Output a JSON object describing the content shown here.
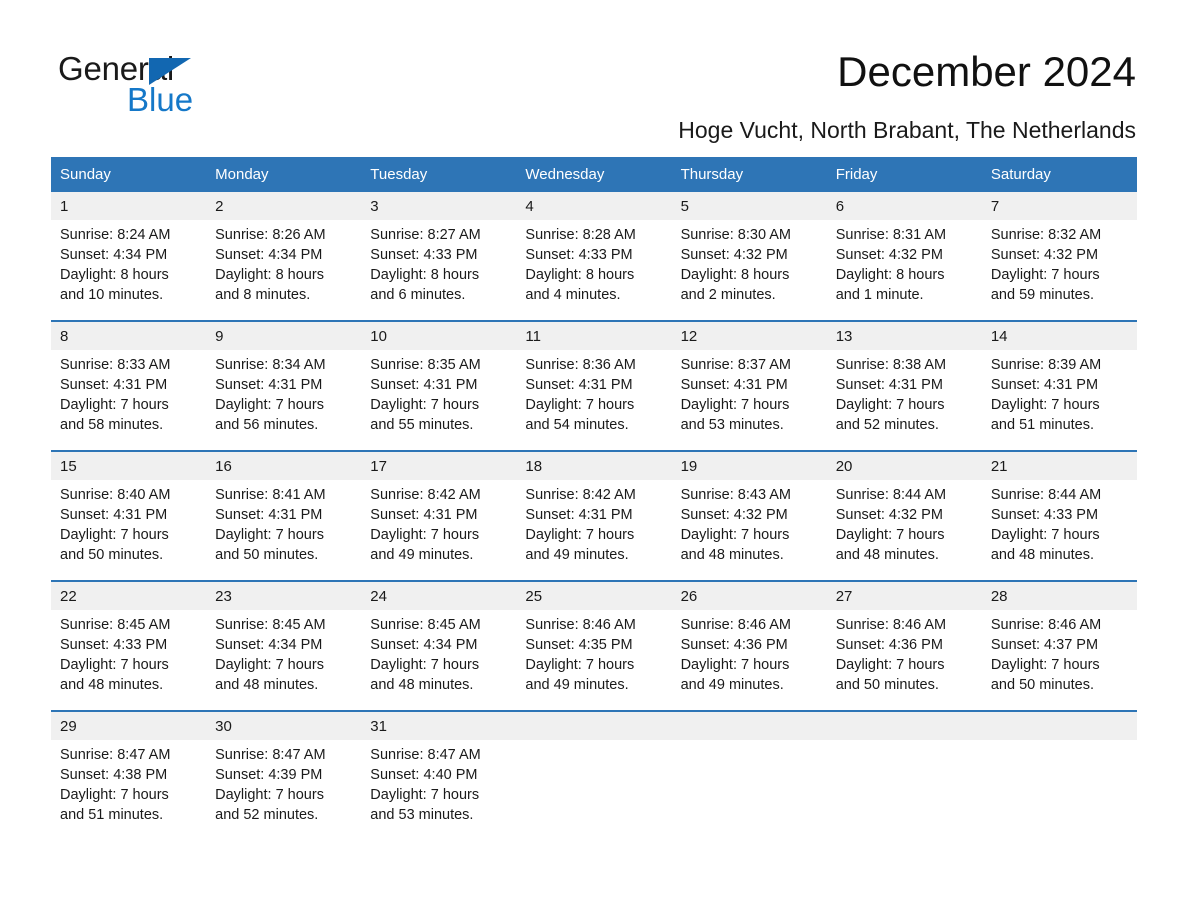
{
  "brand": {
    "name_part1": "General",
    "name_part2": "Blue",
    "accent_color": "#1578c8",
    "triangle_color": "#1267b1"
  },
  "header": {
    "title": "December 2024",
    "subtitle": "Hoge Vucht, North Brabant, The Netherlands"
  },
  "theme": {
    "header_band": "#2e75b6",
    "daynum_strip": "#f0f0f0",
    "row_divider": "#2e75b6"
  },
  "weekday_headers": [
    "Sunday",
    "Monday",
    "Tuesday",
    "Wednesday",
    "Thursday",
    "Friday",
    "Saturday"
  ],
  "weeks": [
    {
      "days": [
        {
          "day": "1",
          "sunrise": "Sunrise: 8:24 AM",
          "sunset": "Sunset: 4:34 PM",
          "daylight_1": "Daylight: 8 hours",
          "daylight_2": "and 10 minutes."
        },
        {
          "day": "2",
          "sunrise": "Sunrise: 8:26 AM",
          "sunset": "Sunset: 4:34 PM",
          "daylight_1": "Daylight: 8 hours",
          "daylight_2": "and 8 minutes."
        },
        {
          "day": "3",
          "sunrise": "Sunrise: 8:27 AM",
          "sunset": "Sunset: 4:33 PM",
          "daylight_1": "Daylight: 8 hours",
          "daylight_2": "and 6 minutes."
        },
        {
          "day": "4",
          "sunrise": "Sunrise: 8:28 AM",
          "sunset": "Sunset: 4:33 PM",
          "daylight_1": "Daylight: 8 hours",
          "daylight_2": "and 4 minutes."
        },
        {
          "day": "5",
          "sunrise": "Sunrise: 8:30 AM",
          "sunset": "Sunset: 4:32 PM",
          "daylight_1": "Daylight: 8 hours",
          "daylight_2": "and 2 minutes."
        },
        {
          "day": "6",
          "sunrise": "Sunrise: 8:31 AM",
          "sunset": "Sunset: 4:32 PM",
          "daylight_1": "Daylight: 8 hours",
          "daylight_2": "and 1 minute."
        },
        {
          "day": "7",
          "sunrise": "Sunrise: 8:32 AM",
          "sunset": "Sunset: 4:32 PM",
          "daylight_1": "Daylight: 7 hours",
          "daylight_2": "and 59 minutes."
        }
      ]
    },
    {
      "days": [
        {
          "day": "8",
          "sunrise": "Sunrise: 8:33 AM",
          "sunset": "Sunset: 4:31 PM",
          "daylight_1": "Daylight: 7 hours",
          "daylight_2": "and 58 minutes."
        },
        {
          "day": "9",
          "sunrise": "Sunrise: 8:34 AM",
          "sunset": "Sunset: 4:31 PM",
          "daylight_1": "Daylight: 7 hours",
          "daylight_2": "and 56 minutes."
        },
        {
          "day": "10",
          "sunrise": "Sunrise: 8:35 AM",
          "sunset": "Sunset: 4:31 PM",
          "daylight_1": "Daylight: 7 hours",
          "daylight_2": "and 55 minutes."
        },
        {
          "day": "11",
          "sunrise": "Sunrise: 8:36 AM",
          "sunset": "Sunset: 4:31 PM",
          "daylight_1": "Daylight: 7 hours",
          "daylight_2": "and 54 minutes."
        },
        {
          "day": "12",
          "sunrise": "Sunrise: 8:37 AM",
          "sunset": "Sunset: 4:31 PM",
          "daylight_1": "Daylight: 7 hours",
          "daylight_2": "and 53 minutes."
        },
        {
          "day": "13",
          "sunrise": "Sunrise: 8:38 AM",
          "sunset": "Sunset: 4:31 PM",
          "daylight_1": "Daylight: 7 hours",
          "daylight_2": "and 52 minutes."
        },
        {
          "day": "14",
          "sunrise": "Sunrise: 8:39 AM",
          "sunset": "Sunset: 4:31 PM",
          "daylight_1": "Daylight: 7 hours",
          "daylight_2": "and 51 minutes."
        }
      ]
    },
    {
      "days": [
        {
          "day": "15",
          "sunrise": "Sunrise: 8:40 AM",
          "sunset": "Sunset: 4:31 PM",
          "daylight_1": "Daylight: 7 hours",
          "daylight_2": "and 50 minutes."
        },
        {
          "day": "16",
          "sunrise": "Sunrise: 8:41 AM",
          "sunset": "Sunset: 4:31 PM",
          "daylight_1": "Daylight: 7 hours",
          "daylight_2": "and 50 minutes."
        },
        {
          "day": "17",
          "sunrise": "Sunrise: 8:42 AM",
          "sunset": "Sunset: 4:31 PM",
          "daylight_1": "Daylight: 7 hours",
          "daylight_2": "and 49 minutes."
        },
        {
          "day": "18",
          "sunrise": "Sunrise: 8:42 AM",
          "sunset": "Sunset: 4:31 PM",
          "daylight_1": "Daylight: 7 hours",
          "daylight_2": "and 49 minutes."
        },
        {
          "day": "19",
          "sunrise": "Sunrise: 8:43 AM",
          "sunset": "Sunset: 4:32 PM",
          "daylight_1": "Daylight: 7 hours",
          "daylight_2": "and 48 minutes."
        },
        {
          "day": "20",
          "sunrise": "Sunrise: 8:44 AM",
          "sunset": "Sunset: 4:32 PM",
          "daylight_1": "Daylight: 7 hours",
          "daylight_2": "and 48 minutes."
        },
        {
          "day": "21",
          "sunrise": "Sunrise: 8:44 AM",
          "sunset": "Sunset: 4:33 PM",
          "daylight_1": "Daylight: 7 hours",
          "daylight_2": "and 48 minutes."
        }
      ]
    },
    {
      "days": [
        {
          "day": "22",
          "sunrise": "Sunrise: 8:45 AM",
          "sunset": "Sunset: 4:33 PM",
          "daylight_1": "Daylight: 7 hours",
          "daylight_2": "and 48 minutes."
        },
        {
          "day": "23",
          "sunrise": "Sunrise: 8:45 AM",
          "sunset": "Sunset: 4:34 PM",
          "daylight_1": "Daylight: 7 hours",
          "daylight_2": "and 48 minutes."
        },
        {
          "day": "24",
          "sunrise": "Sunrise: 8:45 AM",
          "sunset": "Sunset: 4:34 PM",
          "daylight_1": "Daylight: 7 hours",
          "daylight_2": "and 48 minutes."
        },
        {
          "day": "25",
          "sunrise": "Sunrise: 8:46 AM",
          "sunset": "Sunset: 4:35 PM",
          "daylight_1": "Daylight: 7 hours",
          "daylight_2": "and 49 minutes."
        },
        {
          "day": "26",
          "sunrise": "Sunrise: 8:46 AM",
          "sunset": "Sunset: 4:36 PM",
          "daylight_1": "Daylight: 7 hours",
          "daylight_2": "and 49 minutes."
        },
        {
          "day": "27",
          "sunrise": "Sunrise: 8:46 AM",
          "sunset": "Sunset: 4:36 PM",
          "daylight_1": "Daylight: 7 hours",
          "daylight_2": "and 50 minutes."
        },
        {
          "day": "28",
          "sunrise": "Sunrise: 8:46 AM",
          "sunset": "Sunset: 4:37 PM",
          "daylight_1": "Daylight: 7 hours",
          "daylight_2": "and 50 minutes."
        }
      ]
    },
    {
      "days": [
        {
          "day": "29",
          "sunrise": "Sunrise: 8:47 AM",
          "sunset": "Sunset: 4:38 PM",
          "daylight_1": "Daylight: 7 hours",
          "daylight_2": "and 51 minutes."
        },
        {
          "day": "30",
          "sunrise": "Sunrise: 8:47 AM",
          "sunset": "Sunset: 4:39 PM",
          "daylight_1": "Daylight: 7 hours",
          "daylight_2": "and 52 minutes."
        },
        {
          "day": "31",
          "sunrise": "Sunrise: 8:47 AM",
          "sunset": "Sunset: 4:40 PM",
          "daylight_1": "Daylight: 7 hours",
          "daylight_2": "and 53 minutes."
        },
        {
          "day": "",
          "sunrise": "",
          "sunset": "",
          "daylight_1": "",
          "daylight_2": ""
        },
        {
          "day": "",
          "sunrise": "",
          "sunset": "",
          "daylight_1": "",
          "daylight_2": ""
        },
        {
          "day": "",
          "sunrise": "",
          "sunset": "",
          "daylight_1": "",
          "daylight_2": ""
        },
        {
          "day": "",
          "sunrise": "",
          "sunset": "",
          "daylight_1": "",
          "daylight_2": ""
        }
      ]
    }
  ]
}
